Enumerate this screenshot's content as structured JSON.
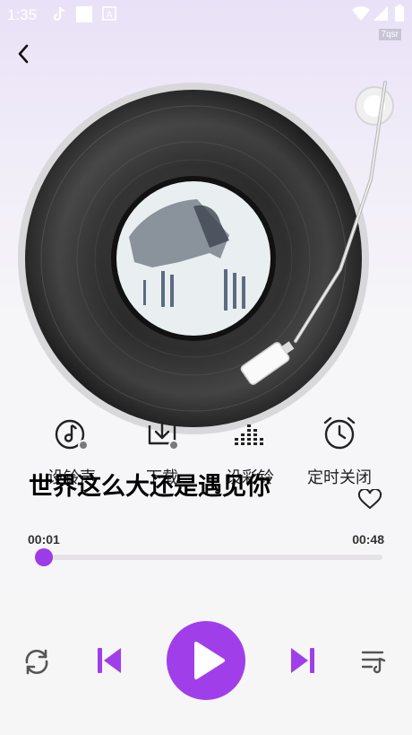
{
  "status": {
    "time": "1:35",
    "watermark": "7qsr"
  },
  "player": {
    "title": "世界这么大还是遇见你",
    "current_time": "00:01",
    "total_time": "00:48",
    "progress": 0.021
  },
  "actions": [
    {
      "label": "设铃声",
      "icon": "music-note-icon"
    },
    {
      "label": "下载",
      "icon": "download-icon"
    },
    {
      "label": "设彩铃",
      "icon": "equalizer-icon"
    },
    {
      "label": "定时关闭",
      "icon": "alarm-clock-icon"
    }
  ],
  "colors": {
    "accent": "#a03fea",
    "track": "#e5e2e7"
  }
}
